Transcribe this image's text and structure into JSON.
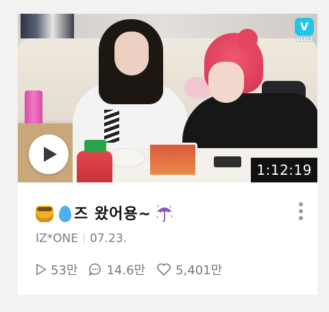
{
  "video": {
    "duration": "1:12:19",
    "channel_logo_text": "VLIVE",
    "logo_glyph": "V"
  },
  "title": {
    "text": "즈 왔어용~",
    "emoji_before": [
      "honey-pot-icon",
      "droplet-icon"
    ],
    "emoji_after": [
      "umbrella-with-rain-icon"
    ]
  },
  "meta": {
    "channel": "IZ*ONE",
    "date": "07.23."
  },
  "stats": {
    "plays": "53만",
    "comments": "14.6만",
    "likes": "5,401만"
  },
  "colors": {
    "background": "#f2f2f2",
    "card": "#ffffff",
    "vlive_accent": "#20c5ea",
    "meta_text": "#7b7b7b"
  },
  "icons": {
    "play": "play-icon",
    "views": "play-outline-icon",
    "comments": "comment-bubble-icon",
    "likes": "heart-outline-icon",
    "menu": "more-vertical-icon"
  }
}
